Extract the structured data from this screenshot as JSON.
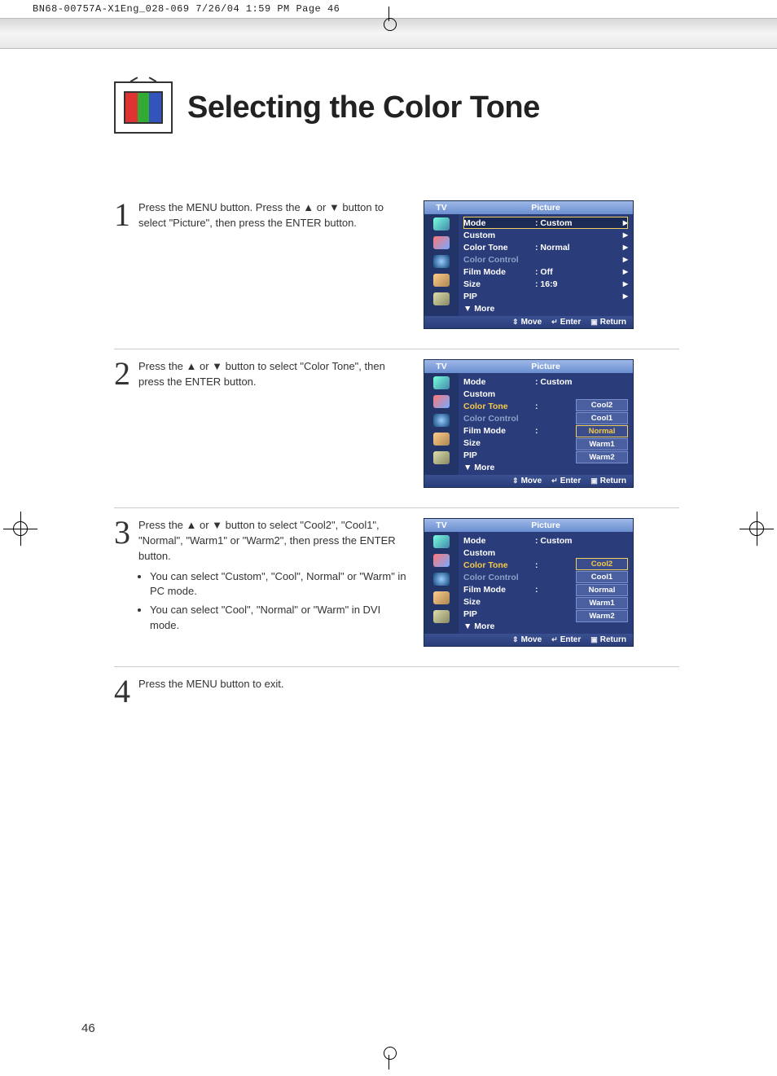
{
  "print_header": "BN68-00757A-X1Eng_028-069  7/26/04  1:59 PM  Page 46",
  "page_title": "Selecting the Color Tone",
  "page_number": "46",
  "steps": {
    "s1": {
      "num": "1",
      "text": "Press the MENU button. Press the ▲ or ▼ button to select \"Picture\", then press the ENTER button."
    },
    "s2": {
      "num": "2",
      "text": "Press the ▲ or ▼ button to select \"Color Tone\", then press the ENTER button."
    },
    "s3": {
      "num": "3",
      "text": "Press the ▲ or ▼ button to select \"Cool2\", \"Cool1\", \"Normal\", \"Warm1\" or \"Warm2\",  then press the ENTER button.",
      "b1": "You can select \"Custom\", \"Cool\", Normal\" or \"Warm\" in PC mode.",
      "b2": "You can select \"Cool\", \"Normal\" or \"Warm\" in DVI mode."
    },
    "s4": {
      "num": "4",
      "text": "Press the MENU button to exit."
    }
  },
  "osd_common": {
    "tv": "TV",
    "title": "Picture",
    "move": "Move",
    "enter": "Enter",
    "return": "Return",
    "more": "▼ More"
  },
  "osd1": {
    "rows": {
      "mode_l": "Mode",
      "mode_v": ":  Custom",
      "custom_l": "Custom",
      "tone_l": "Color Tone",
      "tone_v": ":  Normal",
      "cc_l": "Color Control",
      "film_l": "Film Mode",
      "film_v": ":  Off",
      "size_l": "Size",
      "size_v": ":  16:9",
      "pip_l": "PIP"
    }
  },
  "osd2": {
    "rows": {
      "mode_l": "Mode",
      "mode_v": ":  Custom",
      "custom_l": "Custom",
      "tone_l": "Color Tone",
      "tone_c": ":",
      "cc_l": "Color Control",
      "film_l": "Film Mode",
      "film_c": ":",
      "size_l": "Size",
      "pip_l": "PIP"
    },
    "opts": {
      "o1": "Cool2",
      "o2": "Cool1",
      "o3": "Normal",
      "o4": "Warm1",
      "o5": "Warm2"
    }
  },
  "osd3": {
    "rows": {
      "mode_l": "Mode",
      "mode_v": ":  Custom",
      "custom_l": "Custom",
      "tone_l": "Color Tone",
      "tone_c": ":",
      "cc_l": "Color Control",
      "film_l": "Film Mode",
      "film_c": ":",
      "size_l": "Size",
      "pip_l": "PIP"
    },
    "opts": {
      "o1": "Cool2",
      "o2": "Cool1",
      "o3": "Normal",
      "o4": "Warm1",
      "o5": "Warm2"
    }
  }
}
